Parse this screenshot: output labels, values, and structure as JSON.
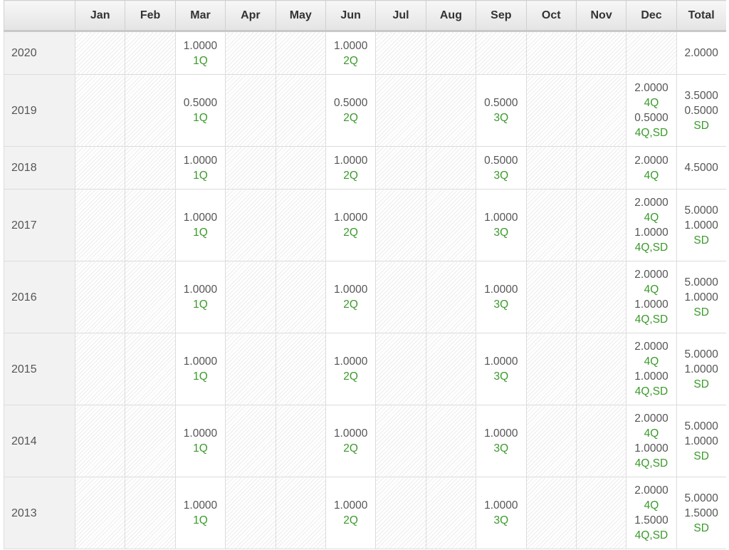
{
  "table": {
    "headers": [
      "",
      "Jan",
      "Feb",
      "Mar",
      "Apr",
      "May",
      "Jun",
      "Jul",
      "Aug",
      "Sep",
      "Oct",
      "Nov",
      "Dec",
      "Total"
    ],
    "rows": [
      {
        "year": "2020",
        "cells": {
          "Mar": [
            {
              "value": "1.0000",
              "code": "1Q"
            }
          ],
          "Jun": [
            {
              "value": "1.0000",
              "code": "2Q"
            }
          ],
          "Total": [
            {
              "value": "2.0000"
            }
          ]
        }
      },
      {
        "year": "2019",
        "cells": {
          "Mar": [
            {
              "value": "0.5000",
              "code": "1Q"
            }
          ],
          "Jun": [
            {
              "value": "0.5000",
              "code": "2Q"
            }
          ],
          "Sep": [
            {
              "value": "0.5000",
              "code": "3Q"
            }
          ],
          "Dec": [
            {
              "value": "2.0000",
              "code": "4Q"
            },
            {
              "value": "0.5000",
              "code": "4Q,SD"
            }
          ],
          "Total": [
            {
              "value": "3.5000"
            },
            {
              "value": "0.5000",
              "code": "SD"
            }
          ]
        }
      },
      {
        "year": "2018",
        "cells": {
          "Mar": [
            {
              "value": "1.0000",
              "code": "1Q"
            }
          ],
          "Jun": [
            {
              "value": "1.0000",
              "code": "2Q"
            }
          ],
          "Sep": [
            {
              "value": "0.5000",
              "code": "3Q"
            }
          ],
          "Dec": [
            {
              "value": "2.0000",
              "code": "4Q"
            }
          ],
          "Total": [
            {
              "value": "4.5000"
            }
          ]
        }
      },
      {
        "year": "2017",
        "cells": {
          "Mar": [
            {
              "value": "1.0000",
              "code": "1Q"
            }
          ],
          "Jun": [
            {
              "value": "1.0000",
              "code": "2Q"
            }
          ],
          "Sep": [
            {
              "value": "1.0000",
              "code": "3Q"
            }
          ],
          "Dec": [
            {
              "value": "2.0000",
              "code": "4Q"
            },
            {
              "value": "1.0000",
              "code": "4Q,SD"
            }
          ],
          "Total": [
            {
              "value": "5.0000"
            },
            {
              "value": "1.0000",
              "code": "SD"
            }
          ]
        }
      },
      {
        "year": "2016",
        "cells": {
          "Mar": [
            {
              "value": "1.0000",
              "code": "1Q"
            }
          ],
          "Jun": [
            {
              "value": "1.0000",
              "code": "2Q"
            }
          ],
          "Sep": [
            {
              "value": "1.0000",
              "code": "3Q"
            }
          ],
          "Dec": [
            {
              "value": "2.0000",
              "code": "4Q"
            },
            {
              "value": "1.0000",
              "code": "4Q,SD"
            }
          ],
          "Total": [
            {
              "value": "5.0000"
            },
            {
              "value": "1.0000",
              "code": "SD"
            }
          ]
        }
      },
      {
        "year": "2015",
        "cells": {
          "Mar": [
            {
              "value": "1.0000",
              "code": "1Q"
            }
          ],
          "Jun": [
            {
              "value": "1.0000",
              "code": "2Q"
            }
          ],
          "Sep": [
            {
              "value": "1.0000",
              "code": "3Q"
            }
          ],
          "Dec": [
            {
              "value": "2.0000",
              "code": "4Q"
            },
            {
              "value": "1.0000",
              "code": "4Q,SD"
            }
          ],
          "Total": [
            {
              "value": "5.0000"
            },
            {
              "value": "1.0000",
              "code": "SD"
            }
          ]
        }
      },
      {
        "year": "2014",
        "cells": {
          "Mar": [
            {
              "value": "1.0000",
              "code": "1Q"
            }
          ],
          "Jun": [
            {
              "value": "1.0000",
              "code": "2Q"
            }
          ],
          "Sep": [
            {
              "value": "1.0000",
              "code": "3Q"
            }
          ],
          "Dec": [
            {
              "value": "2.0000",
              "code": "4Q"
            },
            {
              "value": "1.0000",
              "code": "4Q,SD"
            }
          ],
          "Total": [
            {
              "value": "5.0000"
            },
            {
              "value": "1.0000",
              "code": "SD"
            }
          ]
        }
      },
      {
        "year": "2013",
        "cells": {
          "Mar": [
            {
              "value": "1.0000",
              "code": "1Q"
            }
          ],
          "Jun": [
            {
              "value": "1.0000",
              "code": "2Q"
            }
          ],
          "Sep": [
            {
              "value": "1.0000",
              "code": "3Q"
            }
          ],
          "Dec": [
            {
              "value": "2.0000",
              "code": "4Q"
            },
            {
              "value": "1.5000",
              "code": "4Q,SD"
            }
          ],
          "Total": [
            {
              "value": "5.0000"
            },
            {
              "value": "1.5000",
              "code": "SD"
            }
          ]
        }
      }
    ]
  },
  "colors": {
    "code_text": "#3a9a2a",
    "value_text": "#555555",
    "header_text": "#333333",
    "year_bg": "#f2f2f2"
  }
}
